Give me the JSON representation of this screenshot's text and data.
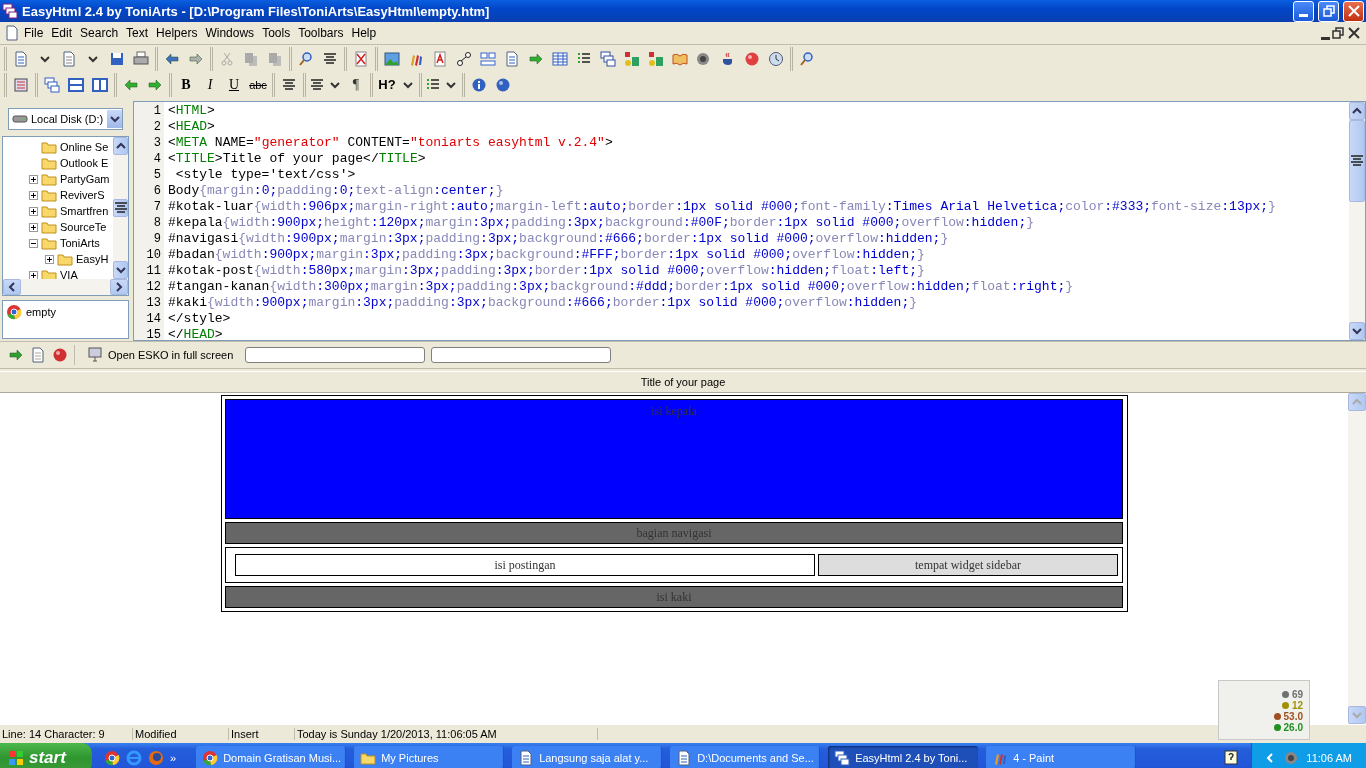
{
  "window": {
    "title": "EasyHtml 2.4 by ToniArts - [D:\\Program Files\\ToniArts\\EasyHtml\\empty.htm]"
  },
  "menu": [
    "File",
    "Edit",
    "Search",
    "Text",
    "Helpers",
    "Windows",
    "Tools",
    "Toolbars",
    "Help"
  ],
  "format_buttons": [
    {
      "kind": "bold",
      "label": "B"
    },
    {
      "kind": "italic",
      "label": "I"
    },
    {
      "kind": "underline",
      "label": "U"
    },
    {
      "kind": "strike",
      "label": "abc"
    }
  ],
  "paragraph_button": "¶",
  "heading_button": "H?",
  "drive_select": {
    "value": "Local Disk (D:)"
  },
  "folder_tree": [
    {
      "kind": "leaf",
      "label": "Online Se"
    },
    {
      "kind": "leaf",
      "label": "Outlook E"
    },
    {
      "kind": "folder",
      "label": "PartyGam",
      "expanded": false
    },
    {
      "kind": "folder",
      "label": "ReviverS",
      "expanded": false
    },
    {
      "kind": "folder",
      "label": "Smartfren",
      "expanded": false
    },
    {
      "kind": "folder",
      "label": "SourceTe",
      "expanded": false
    },
    {
      "kind": "folder",
      "label": "ToniArts",
      "expanded": true,
      "children": [
        {
          "kind": "folder",
          "label": "EasyH",
          "expanded": false
        }
      ]
    },
    {
      "kind": "folder",
      "label": "VIA",
      "expanded": false
    }
  ],
  "open_files": [
    {
      "name": "empty"
    }
  ],
  "editor": {
    "lines": [
      {
        "number": "1",
        "kind": "html",
        "text": "<HTML>"
      },
      {
        "number": "2",
        "kind": "html",
        "text": "<HEAD>"
      },
      {
        "number": "3",
        "kind": "html",
        "text": "<META NAME=\"generator\" CONTENT=\"toniarts easyhtml v.2.4\">"
      },
      {
        "number": "4",
        "kind": "html",
        "text": "<TITLE>Title of your page</TITLE>"
      },
      {
        "number": "5",
        "kind": "plain",
        "text": " <style type='text/css'>"
      },
      {
        "number": "6",
        "kind": "css",
        "text": "Body{margin:0;padding:0;text-align:center;}"
      },
      {
        "number": "7",
        "kind": "css",
        "text": "#kotak-luar{width:906px;margin-right:auto;margin-left:auto;border:1px solid #000;font-family:Times Arial Helvetica;color:#333;font-size:13px;}"
      },
      {
        "number": "8",
        "kind": "css",
        "text": "#kepala{width:900px;height:120px;margin:3px;padding:3px;background:#00F;border:1px solid #000;overflow:hidden;}"
      },
      {
        "number": "9",
        "kind": "css",
        "text": "#navigasi{width:900px;margin:3px;padding:3px;background:#666;border:1px solid #000;overflow:hidden;}"
      },
      {
        "number": "10",
        "kind": "css",
        "text": "#badan{width:900px;margin:3px;padding:3px;background:#FFF;border:1px solid #000;overflow:hidden;}"
      },
      {
        "number": "11",
        "kind": "css",
        "text": "#kotak-post{width:580px;margin:3px;padding:3px;border:1px solid #000;overflow:hidden;float:left;}"
      },
      {
        "number": "12",
        "kind": "css",
        "text": "#tangan-kanan{width:300px;margin:3px;padding:3px;background:#ddd;border:1px solid #000;overflow:hidden;float:right;}"
      },
      {
        "number": "13",
        "kind": "css",
        "text": "#kaki{width:900px;margin:3px;padding:3px;background:#666;border:1px solid #000;overflow:hidden;}"
      },
      {
        "number": "14",
        "kind": "plain",
        "text": "</style>"
      },
      {
        "number": "15",
        "kind": "html",
        "text": "</HEAD>"
      }
    ]
  },
  "bottom_bar": {
    "fullscreen_button": "Open ESKO in full screen"
  },
  "preview": {
    "title": "Title of your page",
    "header": "isi kepala",
    "nav": "bagian navigasi",
    "post": "isi postingan",
    "sidebar": "tempat widget sidebar",
    "footer": "isi kaki"
  },
  "monitor_widget": {
    "readings": [
      {
        "value": "69",
        "color": "#707070"
      },
      {
        "value": "12",
        "color": "#a09000"
      },
      {
        "value": "53.0",
        "color": "#a05020"
      },
      {
        "value": "26.0",
        "color": "#209020"
      }
    ]
  },
  "status_bar": [
    "Line: 14 Character: 9",
    "Modified",
    "Insert",
    "Today is Sunday 1/20/2013, 11:06:05 AM"
  ],
  "taskbar": {
    "start": "start",
    "more": "»",
    "tasks": [
      {
        "label": "Domain Gratisan Musi...",
        "selected": false
      },
      {
        "label": "My Pictures",
        "selected": false
      },
      {
        "label": "Langsung saja alat y...",
        "selected": false
      },
      {
        "label": "D:\\Documents and Se...",
        "selected": false
      },
      {
        "label": "EasyHtml 2.4 by Toni...",
        "selected": true
      },
      {
        "label": "4 - Paint",
        "selected": false
      }
    ],
    "clock": "11:06 AM"
  }
}
